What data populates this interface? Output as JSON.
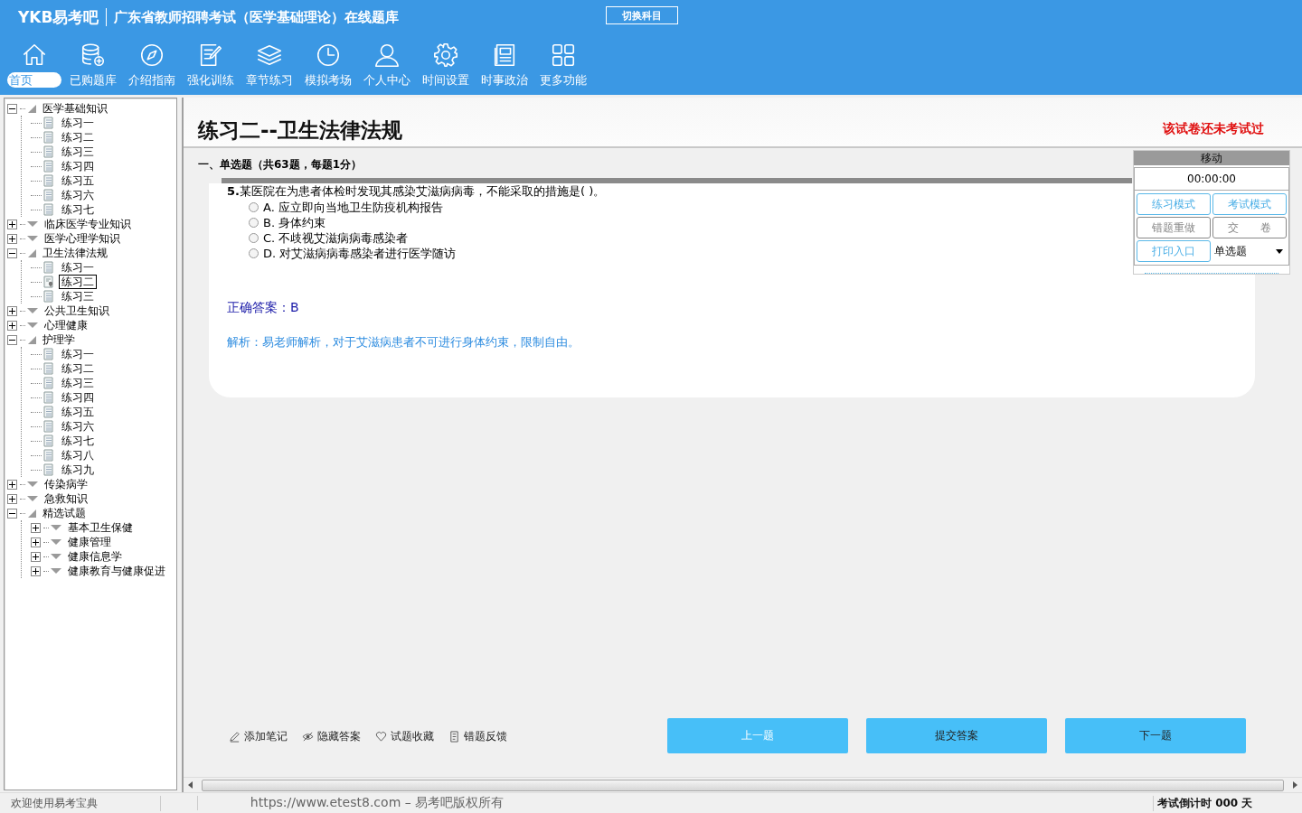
{
  "header": {
    "logo": "YKB易考吧",
    "title": "广东省教师招聘考试（医学基础理论）在线题库",
    "switch_button": "切换科目"
  },
  "nav": [
    {
      "label": "首页",
      "selected": true
    },
    {
      "label": "已购题库",
      "selected": false
    },
    {
      "label": "介绍指南",
      "selected": false
    },
    {
      "label": "强化训练",
      "selected": false
    },
    {
      "label": "章节练习",
      "selected": false
    },
    {
      "label": "模拟考场",
      "selected": false
    },
    {
      "label": "个人中心",
      "selected": false
    },
    {
      "label": "时间设置",
      "selected": false
    },
    {
      "label": "时事政治",
      "selected": false
    },
    {
      "label": "更多功能",
      "selected": false
    }
  ],
  "tree": [
    {
      "kind": "group",
      "label": "医学基础知识",
      "expanded": true,
      "selected": false,
      "children": [
        {
          "kind": "exercise",
          "label": "练习一",
          "selected": false
        },
        {
          "kind": "exercise",
          "label": "练习二",
          "selected": false
        },
        {
          "kind": "exercise",
          "label": "练习三",
          "selected": false
        },
        {
          "kind": "exercise",
          "label": "练习四",
          "selected": false
        },
        {
          "kind": "exercise",
          "label": "练习五",
          "selected": false
        },
        {
          "kind": "exercise",
          "label": "练习六",
          "selected": false
        },
        {
          "kind": "exercise",
          "label": "练习七",
          "selected": false
        }
      ]
    },
    {
      "kind": "group",
      "label": "临床医学专业知识",
      "expanded": false,
      "selected": false
    },
    {
      "kind": "group",
      "label": "医学心理学知识",
      "expanded": false,
      "selected": false
    },
    {
      "kind": "group",
      "label": "卫生法律法规",
      "expanded": true,
      "selected": false,
      "children": [
        {
          "kind": "exercise",
          "label": "练习一",
          "selected": false
        },
        {
          "kind": "exercise",
          "label": "练习二",
          "selected": true
        },
        {
          "kind": "exercise",
          "label": "练习三",
          "selected": false
        }
      ]
    },
    {
      "kind": "group",
      "label": "公共卫生知识",
      "expanded": false,
      "selected": false
    },
    {
      "kind": "group",
      "label": "心理健康",
      "expanded": false,
      "selected": false
    },
    {
      "kind": "group",
      "label": "护理学",
      "expanded": true,
      "selected": false,
      "children": [
        {
          "kind": "exercise",
          "label": "练习一",
          "selected": false
        },
        {
          "kind": "exercise",
          "label": "练习二",
          "selected": false
        },
        {
          "kind": "exercise",
          "label": "练习三",
          "selected": false
        },
        {
          "kind": "exercise",
          "label": "练习四",
          "selected": false
        },
        {
          "kind": "exercise",
          "label": "练习五",
          "selected": false
        },
        {
          "kind": "exercise",
          "label": "练习六",
          "selected": false
        },
        {
          "kind": "exercise",
          "label": "练习七",
          "selected": false
        },
        {
          "kind": "exercise",
          "label": "练习八",
          "selected": false
        },
        {
          "kind": "exercise",
          "label": "练习九",
          "selected": false
        }
      ]
    },
    {
      "kind": "group",
      "label": "传染病学",
      "expanded": false,
      "selected": false
    },
    {
      "kind": "group",
      "label": "急救知识",
      "expanded": false,
      "selected": false
    },
    {
      "kind": "group",
      "label": "精选试题",
      "expanded": true,
      "selected": false,
      "children": [
        {
          "kind": "group",
          "label": "基本卫生保健",
          "expanded": false,
          "selected": false
        },
        {
          "kind": "group",
          "label": "健康管理",
          "expanded": false,
          "selected": false
        },
        {
          "kind": "group",
          "label": "健康信息学",
          "expanded": false,
          "selected": false
        },
        {
          "kind": "group",
          "label": "健康教育与健康促进",
          "expanded": false,
          "selected": false
        }
      ]
    }
  ],
  "exam": {
    "title": "练习二--卫生法律法规",
    "status": "该试卷还未考试过",
    "section": "一、单选题（共63题，每题1分）"
  },
  "question": {
    "number": "5.",
    "text": "某医院在为患者体检时发现其感染艾滋病病毒，不能采取的措施是( )。",
    "options": [
      {
        "letter": "A.",
        "text": "应立即向当地卫生防疫机构报告",
        "selected": false
      },
      {
        "letter": "B.",
        "text": "身体约束",
        "selected": false
      },
      {
        "letter": "C.",
        "text": "不歧视艾滋病病毒感染者",
        "selected": false
      },
      {
        "letter": "D.",
        "text": "对艾滋病病毒感染者进行医学随访",
        "selected": false
      }
    ],
    "answer": "正确答案：B",
    "analysis": "解析：易老师解析，对于艾滋病患者不可进行身体约束，限制自由。"
  },
  "panel": {
    "title": "移动",
    "timer": "00:00:00",
    "buttons": [
      {
        "label": "练习模式",
        "disabled": false
      },
      {
        "label": "考试模式",
        "disabled": false
      },
      {
        "label": "错题重做",
        "disabled": true
      },
      {
        "label": "交　　卷",
        "disabled": true
      },
      {
        "label": "打印入口",
        "disabled": false
      }
    ],
    "dropdown": "单选题"
  },
  "tools": [
    "添加笔记",
    "隐藏答案",
    "试题收藏",
    "错题反馈"
  ],
  "nav_buttons": [
    {
      "label": "上一题",
      "disabled": true
    },
    {
      "label": "提交答案",
      "disabled": false
    },
    {
      "label": "下一题",
      "disabled": false
    }
  ],
  "status_bar": {
    "welcome": "欢迎使用易考宝典",
    "copyright": "https://www.etest8.com – 易考吧版权所有",
    "countdown": "考试倒计时 000 天"
  }
}
